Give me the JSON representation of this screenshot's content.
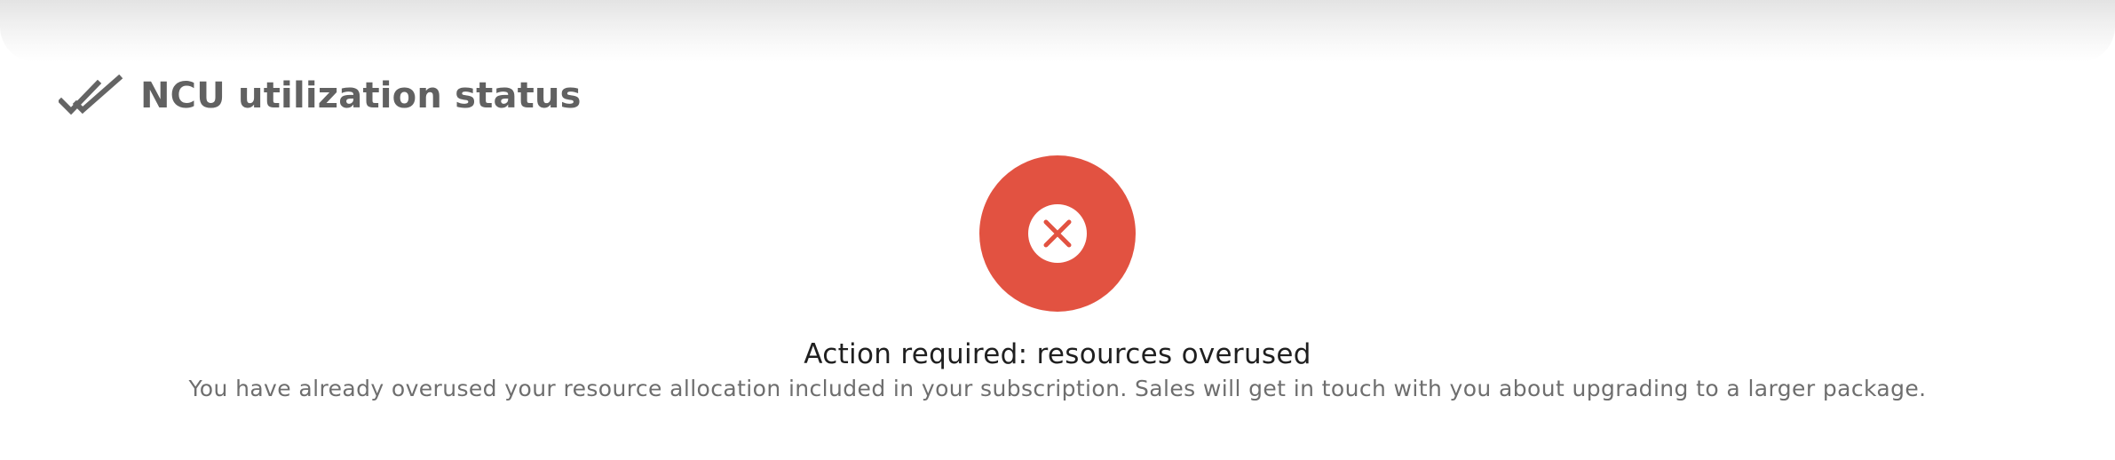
{
  "header": {
    "icon": "double-check-icon",
    "title": "NCU utilization status"
  },
  "status": {
    "icon": "error-x-icon",
    "color": "#e25241",
    "title": "Action required: resources overused",
    "description": "You have already overused your resource allocation included in your subscription. Sales will get in touch with you about upgrading to a larger package."
  }
}
